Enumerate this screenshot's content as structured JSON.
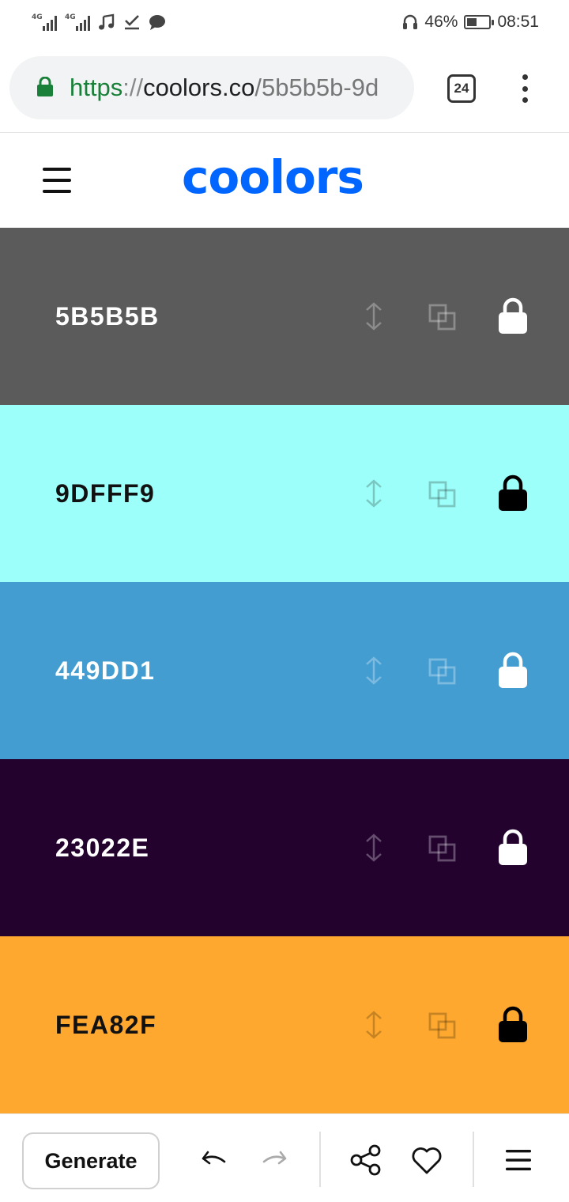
{
  "status_bar": {
    "network_1": "4G",
    "network_2": "4G",
    "battery_percent": "46%",
    "battery_level": 0.46,
    "time": "08:51"
  },
  "browser": {
    "url_scheme": "https",
    "url_separator": "://",
    "url_host": "coolors.co",
    "url_path": "/5b5b5b-9d",
    "tab_count": "24"
  },
  "site": {
    "logo_text": "coolors",
    "brand_color": "#0066ff"
  },
  "palette": [
    {
      "hex": "5B5B5B",
      "color": "#5b5b5b",
      "text_color": "#ffffff",
      "lock_color": "#ffffff",
      "locked": false
    },
    {
      "hex": "9DFFF9",
      "color": "#9dfff9",
      "text_color": "#111111",
      "lock_color": "#000000",
      "locked": true
    },
    {
      "hex": "449DD1",
      "color": "#449dd1",
      "text_color": "#ffffff",
      "lock_color": "#ffffff",
      "locked": false
    },
    {
      "hex": "23022E",
      "color": "#23022e",
      "text_color": "#ffffff",
      "lock_color": "#ffffff",
      "locked": false
    },
    {
      "hex": "FEA82F",
      "color": "#fea82f",
      "text_color": "#111111",
      "lock_color": "#000000",
      "locked": true
    }
  ],
  "toolbar": {
    "generate_label": "Generate",
    "icons": [
      "undo-icon",
      "redo-icon",
      "share-icon",
      "heart-icon",
      "menu-icon"
    ]
  }
}
